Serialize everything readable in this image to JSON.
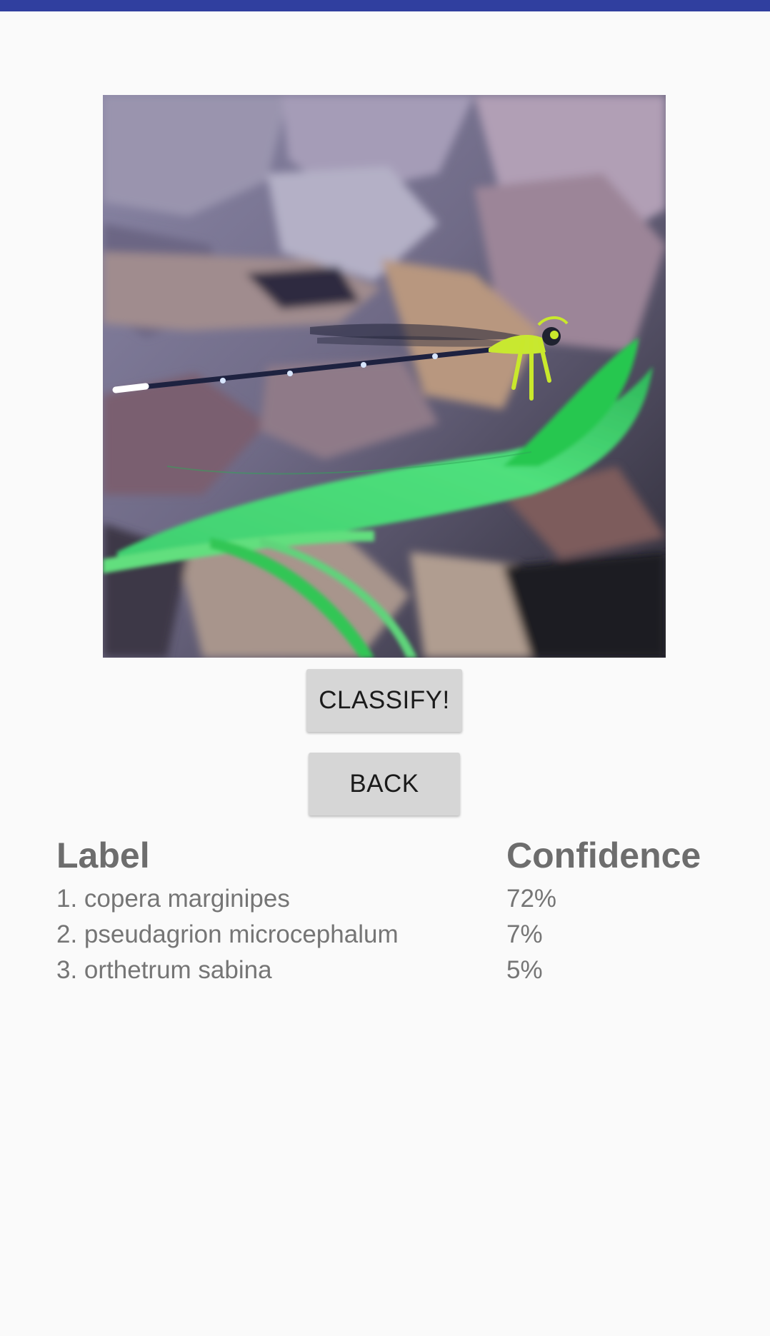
{
  "app": {
    "status_bar_color": "#303f9f",
    "background_color": "#fafafa"
  },
  "image": {
    "subject": "damselfly on green leaf over dry leaf litter"
  },
  "buttons": {
    "classify_label": "CLASSIFY!",
    "back_label": "BACK"
  },
  "results": {
    "header_label": "Label",
    "header_confidence": "Confidence",
    "rows": [
      {
        "label": "1. copera marginipes",
        "confidence": "72%"
      },
      {
        "label": "2. pseudagrion microcephalum",
        "confidence": "7%"
      },
      {
        "label": "3. orthetrum sabina",
        "confidence": "5%"
      }
    ]
  }
}
